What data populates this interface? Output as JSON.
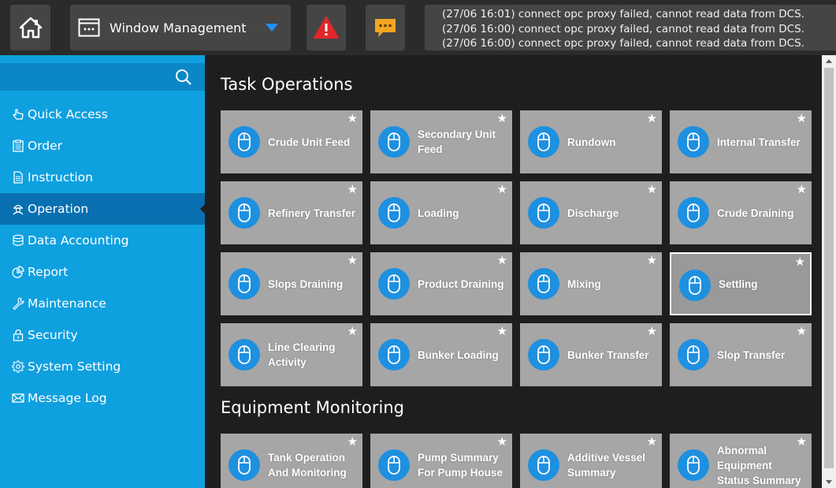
{
  "header": {
    "window_label": "Window Management",
    "log_lines": [
      "(27/06 16:01) connect opc proxy failed, cannot read data from DCS.",
      "(27/06 16:00) connect opc proxy failed, cannot read data from DCS.",
      "(27/06 16:00) connect opc proxy failed, cannot read data from DCS."
    ],
    "icons": {
      "home": "home-icon",
      "window": "window-icon",
      "alarm": "warning-triangle-icon",
      "messages": "chat-bubble-icon"
    }
  },
  "search": {
    "value": "",
    "placeholder": ""
  },
  "sidebar": {
    "items": [
      {
        "label": "Quick Access",
        "icon": "hand-pointer-icon"
      },
      {
        "label": "Order",
        "icon": "clipboard-icon"
      },
      {
        "label": "Instruction",
        "icon": "document-icon"
      },
      {
        "label": "Operation",
        "icon": "operator-icon",
        "active": true
      },
      {
        "label": "Data Accounting",
        "icon": "database-icon"
      },
      {
        "label": "Report",
        "icon": "pie-chart-icon"
      },
      {
        "label": "Maintenance",
        "icon": "wrench-icon"
      },
      {
        "label": "Security",
        "icon": "lock-icon"
      },
      {
        "label": "System Setting",
        "icon": "gear-icon"
      },
      {
        "label": "Message Log",
        "icon": "envelope-icon"
      }
    ]
  },
  "sections": [
    {
      "title": "Task Operations",
      "tiles": [
        {
          "label": "Crude Unit Feed"
        },
        {
          "label": "Secondary Unit Feed"
        },
        {
          "label": "Rundown"
        },
        {
          "label": "Internal Transfer"
        },
        {
          "label": "Refinery Transfer"
        },
        {
          "label": "Loading"
        },
        {
          "label": "Discharge"
        },
        {
          "label": "Crude Draining"
        },
        {
          "label": "Slops Draining"
        },
        {
          "label": "Product Draining"
        },
        {
          "label": "Mixing"
        },
        {
          "label": "Settling",
          "selected": true
        },
        {
          "label": "Line Clearing Activity"
        },
        {
          "label": "Bunker Loading"
        },
        {
          "label": "Bunker Transfer"
        },
        {
          "label": "Slop Transfer"
        }
      ]
    },
    {
      "title": "Equipment Monitoring",
      "tiles": [
        {
          "label": "Tank Operation And Monitoring"
        },
        {
          "label": "Pump Summary For Pump House"
        },
        {
          "label": "Additive Vessel Summary"
        },
        {
          "label": "Abnormal Equipment Status Summary"
        }
      ]
    }
  ],
  "tile_icon": "mouse-icon",
  "star_glyph": "★",
  "colors": {
    "accent": "#0fa0df",
    "active": "#0870b0",
    "tile": "#a6a6a6",
    "icon_circle": "#1e90e0"
  }
}
